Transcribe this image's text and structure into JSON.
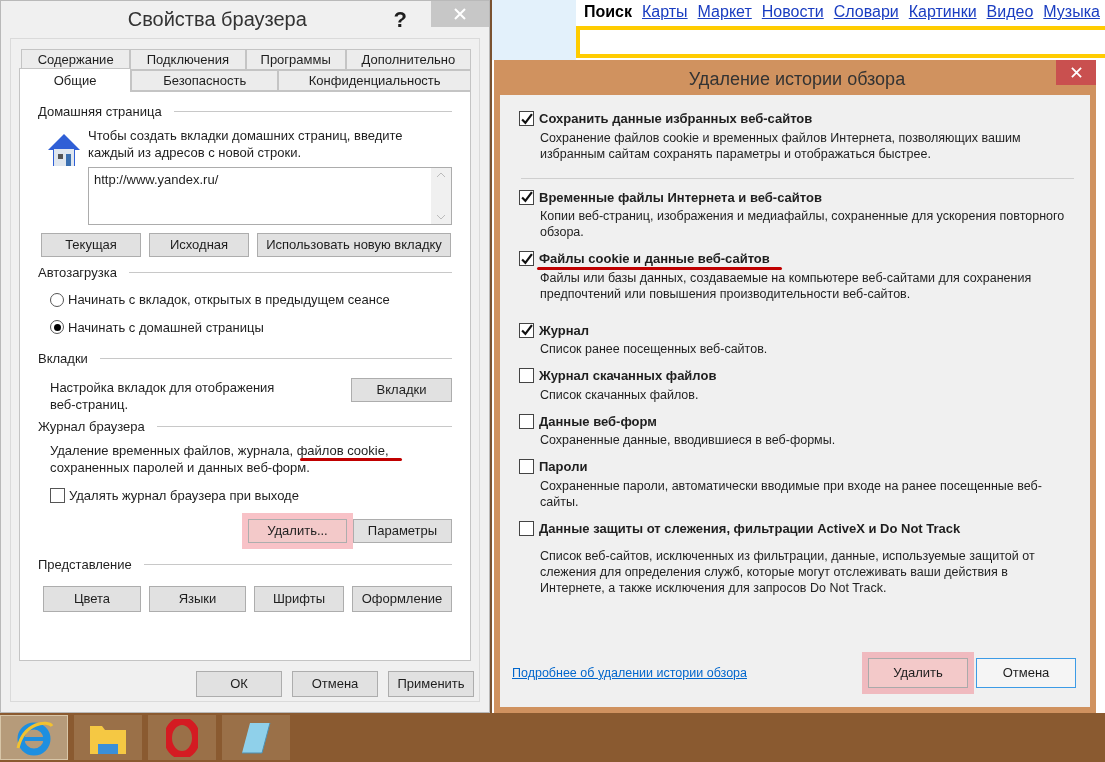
{
  "browser_properties": {
    "title": "Свойства браузера",
    "help": "?",
    "tabs_back": [
      {
        "label": "Содержание",
        "selected": false
      },
      {
        "label": "Подключения",
        "selected": false
      },
      {
        "label": "Программы",
        "selected": false
      },
      {
        "label": "Дополнительно",
        "selected": false
      }
    ],
    "tabs_front": [
      {
        "label": "Общие",
        "selected": true
      },
      {
        "label": "Безопасность",
        "selected": false
      },
      {
        "label": "Конфиденциальность",
        "selected": false
      }
    ],
    "home_page": {
      "heading": "Домашняя страница",
      "note": "Чтобы создать вкладки домашних страниц, введите каждый из адресов с новой строки.",
      "value": "http://www.yandex.ru/",
      "buttons": [
        "Текущая",
        "Исходная",
        "Использовать новую вкладку"
      ]
    },
    "startup": {
      "heading": "Автозагрузка",
      "options": [
        {
          "label": "Начинать с вкладок, открытых в предыдущем сеансе",
          "selected": false
        },
        {
          "label": "Начинать с домашней страницы",
          "selected": true
        }
      ]
    },
    "tabs_section": {
      "heading": "Вкладки",
      "note": "Настройка вкладок для отображения веб-страниц.",
      "button": "Вкладки"
    },
    "history": {
      "heading": "Журнал браузера",
      "note": "Удаление временных файлов, журнала, файлов cookie, сохраненных паролей и данных веб-форм.",
      "note_underlined": true,
      "checkbox": {
        "label": "Удалять журнал браузера при выходе",
        "checked": false
      },
      "buttons": [
        {
          "label": "Удалить...",
          "highlighted": true
        },
        {
          "label": "Параметры",
          "highlighted": false
        }
      ]
    },
    "appearance": {
      "heading": "Представление",
      "buttons": [
        "Цвета",
        "Языки",
        "Шрифты",
        "Оформление"
      ]
    },
    "footer_buttons": [
      "ОК",
      "Отмена",
      "Применить"
    ]
  },
  "web_page": {
    "nav": [
      {
        "label": "Поиск",
        "selected": true
      },
      {
        "label": "Карты",
        "selected": false
      },
      {
        "label": "Маркет",
        "selected": false
      },
      {
        "label": "Новости",
        "selected": false
      },
      {
        "label": "Словари",
        "selected": false
      },
      {
        "label": "Картинки",
        "selected": false
      },
      {
        "label": "Видео",
        "selected": false
      },
      {
        "label": "Музыка",
        "selected": false
      }
    ]
  },
  "delete_history": {
    "title": "Удаление истории обзора",
    "items": [
      {
        "title": "Сохранить данные избранных веб-сайтов",
        "description": "Сохранение файлов cookie и временных файлов Интернета, позволяющих вашим избранным сайтам сохранять параметры и отображаться быстрее.",
        "checked": true,
        "underlined": false
      },
      {
        "title": "Временные файлы Интернета и веб-сайтов",
        "description": "Копии веб-страниц, изображения и медиафайлы, сохраненные для ускорения повторного обзора.",
        "checked": true,
        "underlined": false
      },
      {
        "title": "Файлы cookie и данные веб-сайтов",
        "description": "Файлы или базы данных, создаваемые на компьютере веб-сайтами для сохранения предпочтений или повышения производительности веб-сайтов.",
        "checked": true,
        "underlined": true
      },
      {
        "title": "Журнал",
        "description": "Список ранее посещенных веб-сайтов.",
        "checked": true,
        "underlined": false
      },
      {
        "title": "Журнал скачанных файлов",
        "description": "Список скачанных файлов.",
        "checked": false,
        "underlined": false
      },
      {
        "title": "Данные веб-форм",
        "description": "Сохраненные данные, вводившиеся в веб-формы.",
        "checked": false,
        "underlined": false
      },
      {
        "title": "Пароли",
        "description": "Сохраненные пароли, автоматически вводимые при входе на ранее посещенные веб-сайты.",
        "checked": false,
        "underlined": false
      },
      {
        "title": "Данные защиты от слежения, фильтрации ActiveX и Do Not Track",
        "description": "Список веб-сайтов, исключенных из фильтрации, данные, используемые защитой от слежения для определения служб, которые могут отслеживать ваши действия в Интернете, а также исключения для запросов Do Not Track.",
        "checked": false,
        "underlined": false
      }
    ],
    "link": "Подробнее об удалении истории обзора",
    "buttons": [
      {
        "label": "Удалить",
        "highlighted": true
      },
      {
        "label": "Отмена",
        "highlighted": false
      }
    ]
  },
  "taskbar": {
    "apps": [
      {
        "kind": "browser",
        "selected": true
      },
      {
        "kind": "folder",
        "selected": false
      },
      {
        "kind": "opera",
        "selected": false
      },
      {
        "kind": "notepad",
        "selected": false
      }
    ]
  }
}
